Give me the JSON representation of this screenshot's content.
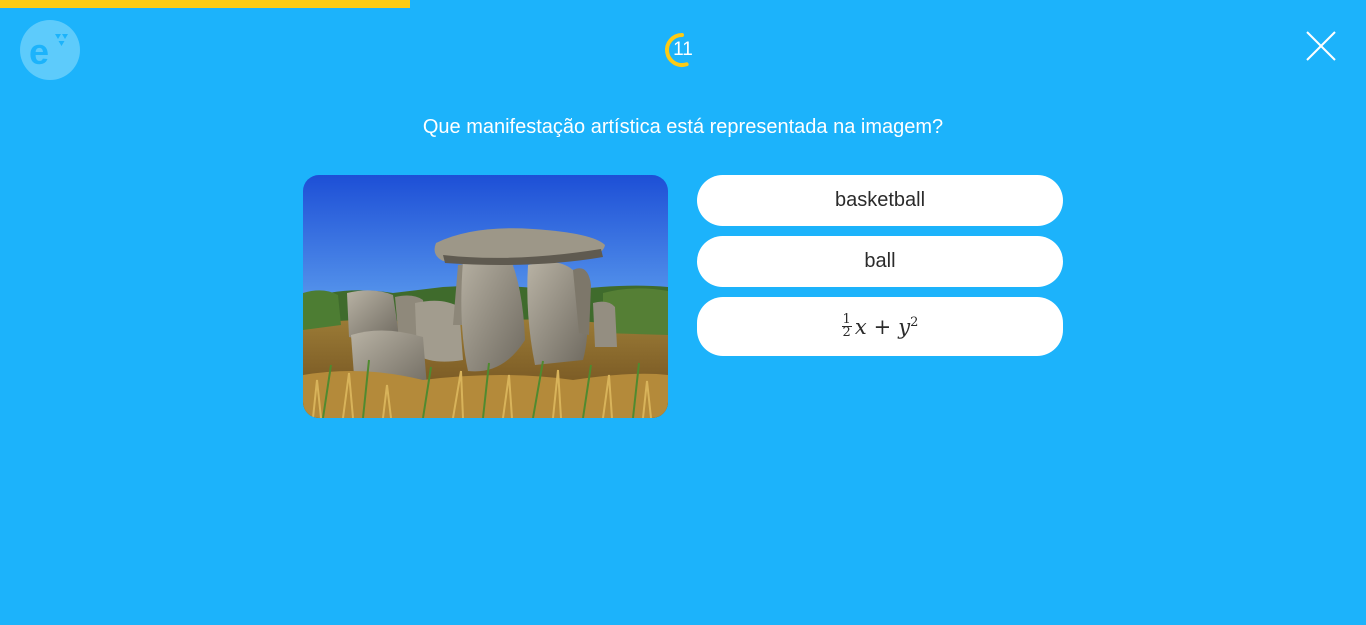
{
  "progress": {
    "fraction": 0.3
  },
  "timer": {
    "value": "11",
    "fraction_remaining": 0.55
  },
  "question": {
    "text": "Que manifestação artística está representada na imagem?"
  },
  "image": {
    "subject": "dolmen-photo"
  },
  "answers": [
    {
      "label": "basketball"
    },
    {
      "label": "ball"
    },
    {
      "numerator": "1",
      "denominator": "2",
      "var_x": "x",
      "operator": "+",
      "var_y": "y",
      "exponent": "2"
    }
  ],
  "colors": {
    "background": "#1cb3fb",
    "progress": "#fccb14",
    "logo_circle": "#5dcbfb",
    "answer_bg": "#ffffff",
    "answer_text": "#2b2b2b"
  },
  "icons": {
    "logo": "educaplay-logo-icon",
    "timer": "timer-ring-icon",
    "close": "close-icon"
  }
}
